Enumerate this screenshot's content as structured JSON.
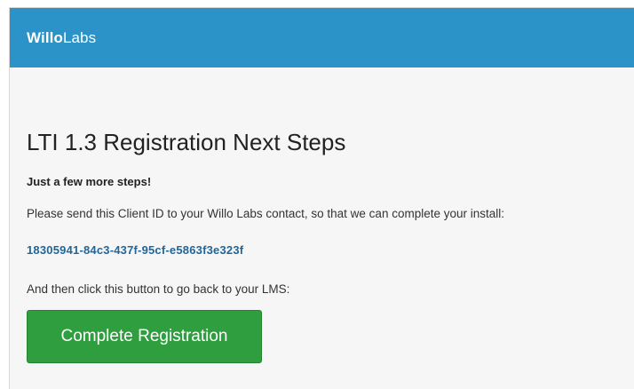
{
  "navbar": {
    "brand_bold": "Willo",
    "brand_light": "Labs",
    "background": "#2b93c7"
  },
  "main": {
    "title": "LTI 1.3 Registration Next Steps",
    "subtitle": "Just a few more steps!",
    "instructions": "Please send this Client ID to your Willo Labs contact, so that we can complete your install:",
    "client_id": "18305941-84c3-437f-95cf-e5863f3e323f",
    "then_text": "And then click this button to go back to your LMS:",
    "button_label": "Complete Registration",
    "button_color": "#2e9e3e",
    "link_color": "#20669a"
  }
}
